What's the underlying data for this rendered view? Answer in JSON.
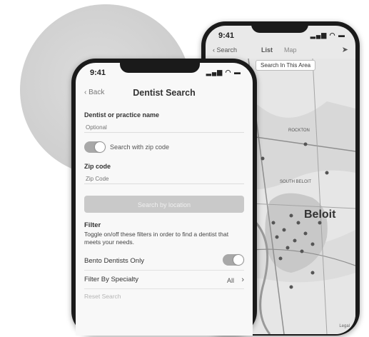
{
  "map_screen": {
    "time": "9:41",
    "status_icons": "▂▄▆ ◠ ▬",
    "search_label": "‹ Search",
    "tab_list": "List",
    "tab_map": "Map",
    "location_icon": "➤",
    "search_area_button": "Search In This Area",
    "city": "Beloit",
    "places": [
      "ROCKTON",
      "SOUTH BELOIT"
    ],
    "legal": "Legal"
  },
  "form_screen": {
    "time": "9:41",
    "status_icons": "▂▄▆ ◠ ▬",
    "back_label": "‹ Back",
    "title": "Dentist Search",
    "name_label": "Dentist or practice name",
    "name_placeholder": "Optional",
    "zip_toggle_label": "Search with zip code",
    "zip_toggle_on": false,
    "zip_label": "Zip code",
    "zip_placeholder": "Zip Code",
    "search_button": "Search by location",
    "filter_title": "Filter",
    "filter_description": "Toggle on/off these filters in order to find a dentist that meets your needs.",
    "bento_label": "Bento Dentists Only",
    "bento_toggle_on": true,
    "specialty_label": "Filter By Specialty",
    "specialty_value": "All",
    "reset_label": "Reset Search"
  },
  "colors": {
    "toggle": "#a8a8a8",
    "button": "#c9c9c9",
    "background_circle": "#d4d4d4"
  }
}
